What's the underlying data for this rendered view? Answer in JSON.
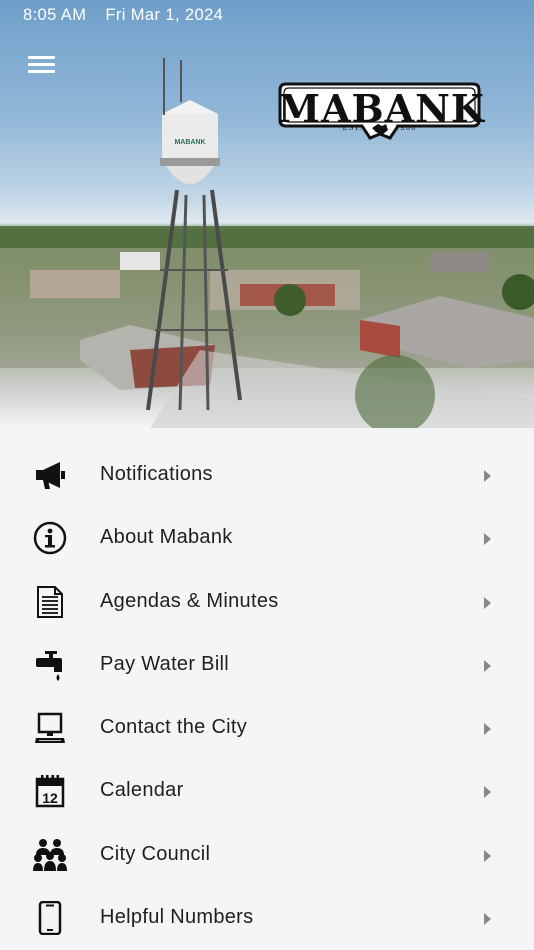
{
  "status_bar": {
    "time": "8:05 AM",
    "date": "Fri Mar 1, 2024"
  },
  "logo": {
    "text": "MABANK",
    "est": "EST.",
    "year": "1900"
  },
  "menu": [
    {
      "label": "Notifications",
      "icon": "megaphone-icon"
    },
    {
      "label": "About Mabank",
      "icon": "info-icon"
    },
    {
      "label": "Agendas & Minutes",
      "icon": "document-icon"
    },
    {
      "label": "Pay Water Bill",
      "icon": "faucet-icon"
    },
    {
      "label": "Contact the City",
      "icon": "computer-icon"
    },
    {
      "label": "Calendar",
      "icon": "calendar-icon"
    },
    {
      "label": "City Council",
      "icon": "group-icon"
    },
    {
      "label": "Helpful Numbers",
      "icon": "phone-icon"
    }
  ],
  "calendar_icon_day": "12"
}
